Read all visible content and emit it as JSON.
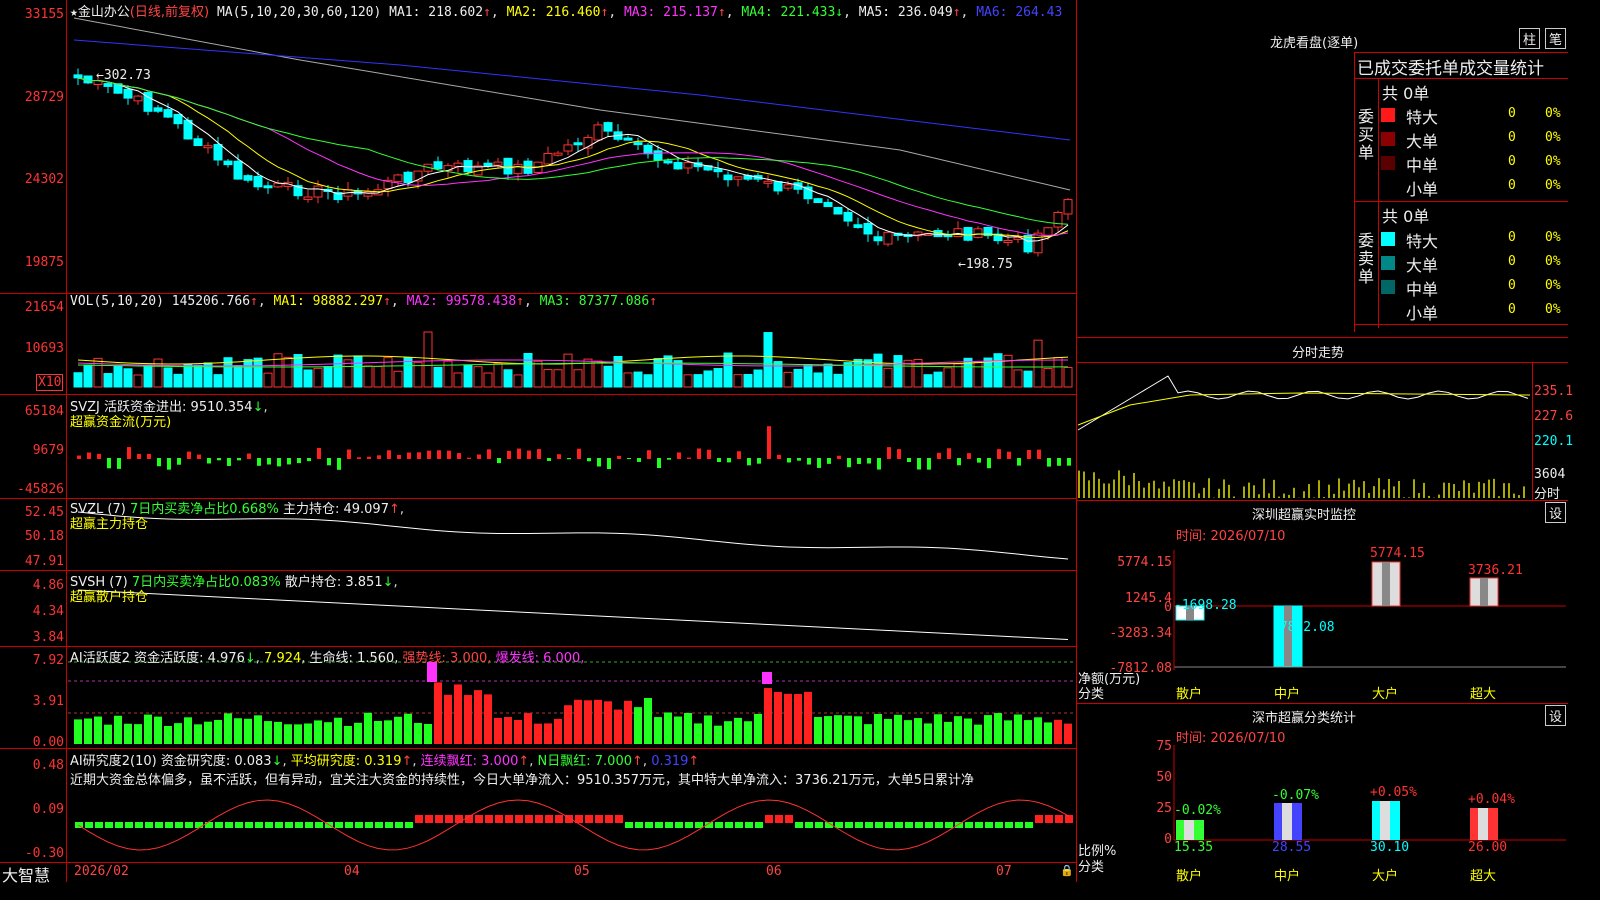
{
  "app": {
    "brand": "大智慧",
    "stock": "金山办公",
    "period": "(日线,前复权)"
  },
  "main": {
    "ma_line": {
      "p0": "MA(5,10,20,30,60,120)",
      "ma1": "MA1: 218.602",
      "ma2": "MA2: 216.460",
      "ma3": "MA3: 215.137",
      "ma4": "MA4: 221.433",
      "ma5": "MA5: 236.049",
      "ma6": "MA6: 264.43"
    },
    "axis": [
      "33155",
      "28729",
      "24302",
      "19875"
    ],
    "high_label": "302.73",
    "low_label": "198.75"
  },
  "vol": {
    "title": "VOL(5,10,20)",
    "v": "145206.766",
    "ma1": "MA1: 98882.297",
    "ma2": "MA2: 99578.438",
    "ma3": "MA3: 87377.086",
    "axis": [
      "21654",
      "10693"
    ],
    "unit": "X10"
  },
  "svzj": {
    "title": "SVZJ",
    "label": "活跃资金进出: 9510.354",
    "sub": "超赢资金流(万元)",
    "axis": [
      "65184",
      "9679",
      "-45826"
    ]
  },
  "svzl": {
    "title": "SVZL (7)",
    "label1": "7日内买卖净占比0.668%",
    "label2": "主力持仓: 49.097",
    "sub": "超赢主力持仓",
    "axis": [
      "52.45",
      "50.18",
      "47.91"
    ]
  },
  "svsh": {
    "title": "SVSH (7)",
    "label1": "7日内买卖净占比0.083%",
    "label2": "散户持仓: 3.851",
    "sub": "超赢散户持仓",
    "axis": [
      "4.86",
      "4.34",
      "3.84"
    ]
  },
  "ai1": {
    "title": "AI活跃度2",
    "l1": "资金活跃度: 4.976",
    "l2": "7.924",
    "l3": "生命线: 1.560,",
    "l4": "强势线: 3.000,",
    "l5": "爆发线: 6.000,",
    "axis": [
      "7.92",
      "3.91",
      "0.00"
    ]
  },
  "ai2": {
    "title": "AI研究度2(10)",
    "l1": "资金研究度: 0.083",
    "l2": "平均研究度: 0.319",
    "l3": "连续飘红: 3.000",
    "l4": "N日飘红: 7.000",
    "l5": "0.319",
    "desc": "近期大资金总体偏多，虽不活跃，但有异动，宜关注大资金的持续性，今日大单净流入：9510.357万元，其中特大单净流入：3736.21万元，大单5日累计净",
    "axis": [
      "0.48",
      "0.09",
      "-0.30"
    ]
  },
  "dates": [
    "2026/02",
    "04",
    "05",
    "06",
    "07"
  ],
  "lhb": {
    "title": "龙虎看盘(逐单)",
    "btn_col": "柱",
    "btn_pen": "笔",
    "header": "已成交委托单成交量统计",
    "buy_side": "委买单",
    "sell_side": "委卖单",
    "count_label": "共 0单",
    "rows": [
      {
        "name": "特大",
        "v": "0",
        "p": "0%"
      },
      {
        "name": "大单",
        "v": "0",
        "p": "0%"
      },
      {
        "name": "中单",
        "v": "0",
        "p": "0%"
      },
      {
        "name": "小单",
        "v": "0",
        "p": "0%"
      }
    ]
  },
  "fenshi": {
    "title": "分时走势",
    "axis": [
      "235.1",
      "227.6",
      "220.1"
    ],
    "vol_axis": "3604",
    "vol_unit": "分时"
  },
  "szjk": {
    "title": "深圳超赢实时监控",
    "btn": "设",
    "time": "时间: 2026/07/10",
    "axis": [
      "5774.15",
      "1245.4",
      "-3283.34",
      "-7812.08"
    ],
    "zero": "0",
    "ylab1": "净额(万元)",
    "ylab2": "分类",
    "bars": [
      {
        "cat": "散户",
        "val": "-1698.28"
      },
      {
        "cat": "中户",
        "val": "-7812.08"
      },
      {
        "cat": "大户",
        "val": "5774.15"
      },
      {
        "cat": "超大",
        "val": "3736.21"
      }
    ]
  },
  "sztj": {
    "title": "深市超赢分类统计",
    "btn": "设",
    "time": "时间: 2026/07/10",
    "axis": [
      "75",
      "50",
      "25",
      "0"
    ],
    "ylab1": "比例%",
    "ylab2": "分类",
    "bars": [
      {
        "cat": "散户",
        "val": "15.35",
        "chg": "-0.02%"
      },
      {
        "cat": "中户",
        "val": "28.55",
        "chg": "-0.07%"
      },
      {
        "cat": "大户",
        "val": "30.10",
        "chg": "+0.05%"
      },
      {
        "cat": "超大",
        "val": "26.00",
        "chg": "+0.04%"
      }
    ]
  },
  "colors": {
    "up": "#ff3232",
    "down": "#00ffff",
    "grid": "#c00000",
    "ma1": "#ffffff",
    "ma2": "#ffff00",
    "ma3": "#ff33ff",
    "ma4": "#33ff33",
    "ma5": "#c8c8c8",
    "ma6": "#3333ff"
  }
}
